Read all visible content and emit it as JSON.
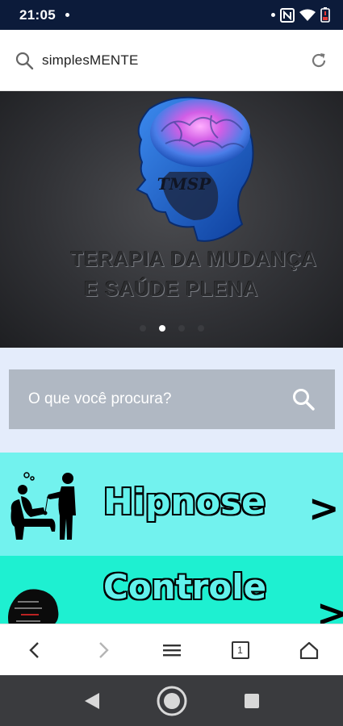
{
  "status_bar": {
    "time": "21:05",
    "icons": [
      "notification-dot-icon",
      "nfc-icon",
      "wifi-icon",
      "battery-low-icon"
    ]
  },
  "url_bar": {
    "text": "simplesMENTE",
    "icons": [
      "search-icon",
      "reload-icon"
    ]
  },
  "hero": {
    "logo_text": "TMSP",
    "title_line1": "TERAPIA DA MUDANÇA",
    "title_line2": "E SAÚDE PLENA",
    "slides_count": 4,
    "active_slide": 2
  },
  "search": {
    "placeholder": "O que você procura?"
  },
  "menu": {
    "items": [
      {
        "label": "Hipnose",
        "icon": "hypnotherapy-session-icon",
        "chevron": ">"
      },
      {
        "label": "Controle Emocional",
        "visible_label": "Controle",
        "icon": "head-words-icon",
        "chevron": ">"
      }
    ]
  },
  "browser_nav": {
    "tab_count": "1",
    "icons": [
      "back-icon",
      "forward-icon",
      "menu-icon",
      "tabs-icon",
      "home-icon"
    ]
  },
  "system_nav": {
    "icons": [
      "system-back-icon",
      "system-home-icon",
      "system-recents-icon"
    ]
  },
  "colors": {
    "status_bar": "#0c1b3a",
    "search_section": "#e4ecfb",
    "search_box": "#b0b8c3",
    "card_hipnose": "#72f2ee",
    "card_controle": "#1ef0d1",
    "system_nav": "#3a3b3e"
  }
}
